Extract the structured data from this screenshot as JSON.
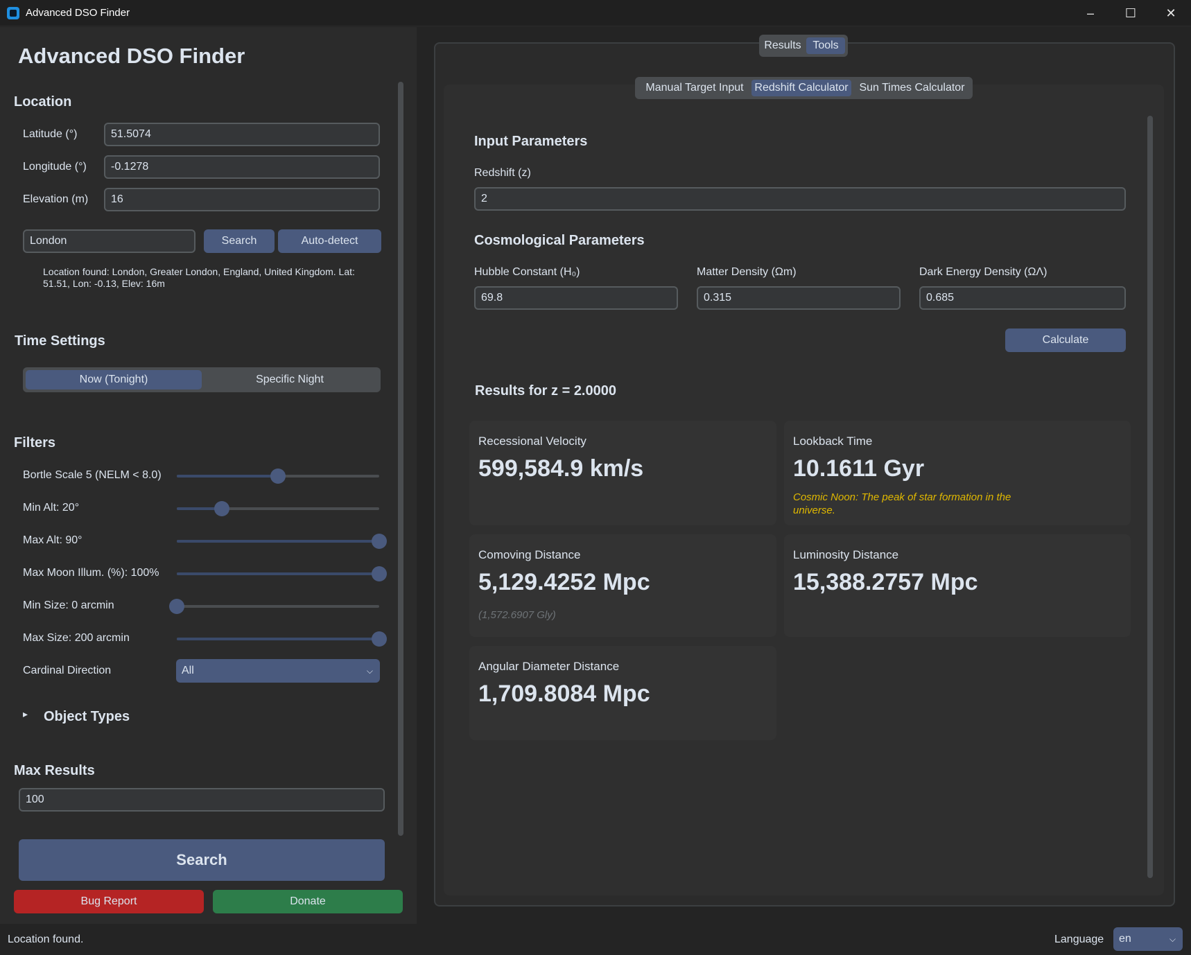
{
  "window": {
    "title": "Advanced DSO Finder",
    "minimize": "–",
    "maximize": "☐",
    "close": "✕"
  },
  "sidebar": {
    "app_title": "Advanced DSO Finder",
    "location": {
      "heading": "Location",
      "latitude_label": "Latitude (°)",
      "latitude_value": "51.5074",
      "longitude_label": "Longitude (°)",
      "longitude_value": "-0.1278",
      "elevation_label": "Elevation (m)",
      "elevation_value": "16",
      "search_value": "London",
      "search_button": "Search",
      "autodetect_button": "Auto-detect",
      "found_note": "Location found: London, Greater London, England, United Kingdom. Lat: 51.51, Lon: -0.13, Elev: 16m"
    },
    "time": {
      "heading": "Time Settings",
      "options": [
        "Now (Tonight)",
        "Specific Night"
      ],
      "selected": "Now (Tonight)"
    },
    "filters": {
      "heading": "Filters",
      "sliders": [
        {
          "label": "Bortle Scale 5 (NELM < 8.0)",
          "value": 0.5
        },
        {
          "label": "Min Alt: 20°",
          "value": 0.222
        },
        {
          "label": "Max Alt: 90°",
          "value": 1.0
        },
        {
          "label": "Max Moon Illum. (%): 100%",
          "value": 1.0
        },
        {
          "label": "Min Size: 0 arcmin",
          "value": 0.0
        },
        {
          "label": "Max Size: 200 arcmin",
          "value": 1.0
        }
      ],
      "cardinal_label": "Cardinal Direction",
      "cardinal_value": "All",
      "object_types": "Object Types",
      "expander_icon": "▸"
    },
    "max_results": {
      "heading": "Max Results",
      "value": "100"
    },
    "search_button": "Search",
    "bug_report_button": "Bug Report",
    "donate_button": "Donate"
  },
  "status": {
    "message": "Location found.",
    "language_label": "Language",
    "language_value": "en"
  },
  "main": {
    "tabs": [
      "Results",
      "Tools"
    ],
    "active_tab": "Tools",
    "subtabs": [
      "Manual Target Input",
      "Redshift Calculator",
      "Sun Times Calculator"
    ],
    "active_subtab": "Redshift Calculator",
    "input_heading": "Input Parameters",
    "redshift_label": "Redshift (z)",
    "redshift_value": "2",
    "cosmo_heading": "Cosmological Parameters",
    "hubble_label": "Hubble Constant (H₀)",
    "hubble_value": "69.8",
    "matter_label": "Matter Density (Ωm)",
    "matter_value": "0.315",
    "dark_label": "Dark Energy Density (ΩΛ)",
    "dark_value": "0.685",
    "calculate_button": "Calculate",
    "results_heading": "Results for z = 2.0000",
    "results": {
      "velocity_label": "Recessional Velocity",
      "velocity_value": "599,584.9 km/s",
      "lookback_label": "Lookback Time",
      "lookback_value": "10.1611 Gyr",
      "lookback_note": "Cosmic Noon: The peak of star formation in the universe.",
      "comoving_label": "Comoving Distance",
      "comoving_value": "5,129.4252 Mpc",
      "comoving_note": "(1,572.6907 Gly)",
      "luminosity_label": "Luminosity Distance",
      "luminosity_value": "15,388.2757 Mpc",
      "angular_label": "Angular Diameter Distance",
      "angular_value": "1,709.8084 Mpc"
    }
  },
  "colors": {
    "accent": "#4a5a7e",
    "bug": "#b52424",
    "donate": "#2d7d4a",
    "note_yellow": "#e0b800",
    "note_gray": "#6e7377"
  }
}
